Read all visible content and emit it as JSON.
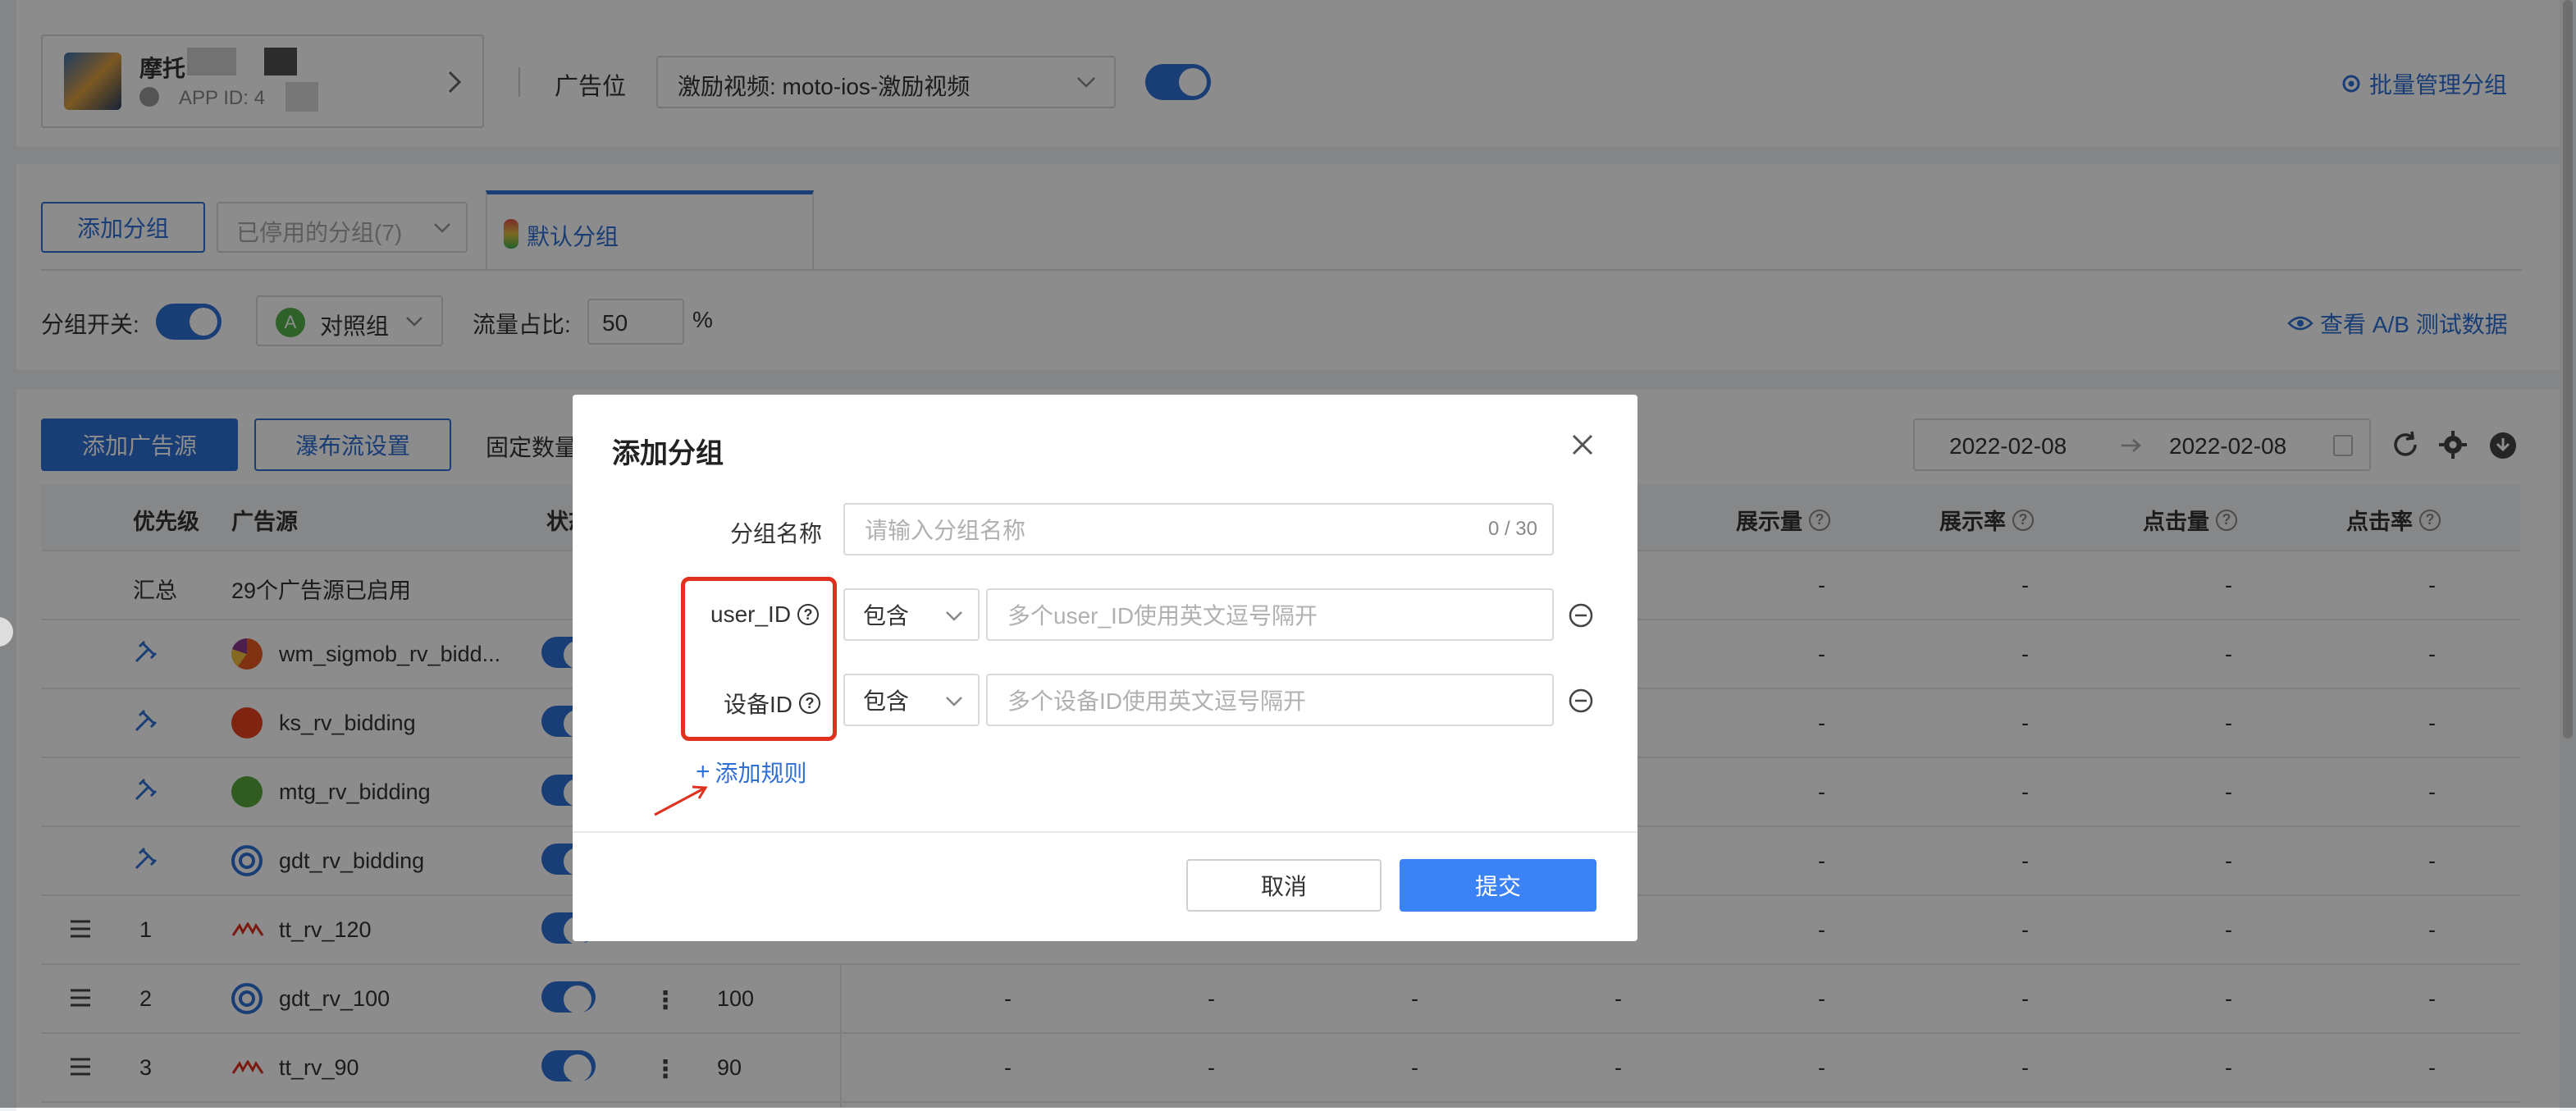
{
  "topbar": {
    "app_name": "摩托",
    "app_id_label": "APP ID: 4",
    "ad_slot_label": "广告位",
    "ad_slot_value": "激励视频: moto-ios-激励视频",
    "batch_manage": "批量管理分组"
  },
  "groups": {
    "add_group": "添加分组",
    "disabled_groups": "已停用的分组(7)",
    "default_group": "默认分组",
    "group_switch_label": "分组开关:",
    "control_group": "对照组",
    "control_badge": "A",
    "traffic_label": "流量占比:",
    "traffic_value": "50",
    "percent": "%",
    "view_ab": "查看 A/B 测试数据"
  },
  "toolbar": {
    "add_source": "添加广告源",
    "waterfall": "瀑布流设置",
    "fixed_count": "固定数量",
    "date_start": "2022-02-08",
    "date_end": "2022-02-08"
  },
  "table": {
    "headers": {
      "priority": "优先级",
      "source": "广告源",
      "status": "状态",
      "impressions": "展示量",
      "impression_rate": "展示率",
      "clicks": "点击量",
      "ctr": "点击率"
    },
    "summary": {
      "label": "汇总",
      "text": "29个广告源已启用"
    },
    "rows": [
      {
        "priority": "",
        "name": "wm_sigmob_rv_bidd..."
      },
      {
        "priority": "",
        "name": "ks_rv_bidding"
      },
      {
        "priority": "",
        "name": "mtg_rv_bidding"
      },
      {
        "priority": "",
        "name": "gdt_rv_bidding"
      },
      {
        "priority": "1",
        "name": "tt_rv_120"
      },
      {
        "priority": "2",
        "name": "gdt_rv_100",
        "price": "100"
      },
      {
        "priority": "3",
        "name": "tt_rv_90",
        "price": "90"
      }
    ],
    "dash": "-"
  },
  "modal": {
    "title": "添加分组",
    "name_label": "分组名称",
    "name_placeholder": "请输入分组名称",
    "name_counter": "0 / 30",
    "user_id_label": "user_ID",
    "device_id_label": "设备ID",
    "contains": "包含",
    "user_id_placeholder": "多个user_ID使用英文逗号隔开",
    "device_id_placeholder": "多个设备ID使用英文逗号隔开",
    "add_rule": "添加规则",
    "cancel": "取消",
    "submit": "提交"
  },
  "colors": {
    "primary": "#2f6fd6",
    "highlight": "#e0301e"
  }
}
